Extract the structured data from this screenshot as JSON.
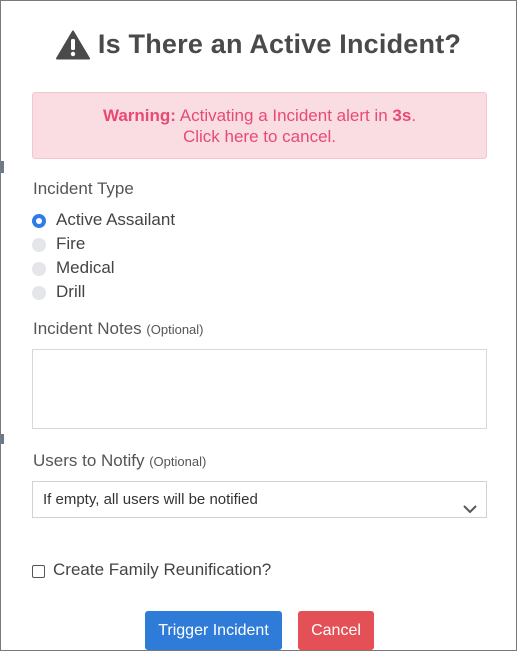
{
  "modal": {
    "title": "Is There an Active Incident?",
    "title_icon": "warning-triangle-icon"
  },
  "alert": {
    "bold_prefix": "Warning:",
    "message_mid": "Activating a Incident alert in",
    "countdown": "3s",
    "message_end": ".",
    "cancel_text": "Click here to cancel."
  },
  "incident_type": {
    "label": "Incident Type",
    "options": [
      "Active Assailant",
      "Fire",
      "Medical",
      "Drill"
    ],
    "selected": "Active Assailant"
  },
  "notes": {
    "label": "Incident Notes",
    "optional": "(Optional)",
    "value": ""
  },
  "users": {
    "label": "Users to Notify",
    "optional": "(Optional)",
    "placeholder": "If empty, all users will be notified"
  },
  "reunification": {
    "label": "Create Family Reunification?",
    "checked": false
  },
  "buttons": {
    "trigger": "Trigger Incident",
    "cancel": "Cancel"
  },
  "colors": {
    "primary": "#2f7cd8",
    "danger": "#e35157",
    "alert_bg": "#f9dde2",
    "alert_text": "#e84a73",
    "radio_checked": "#2f7ce8"
  }
}
